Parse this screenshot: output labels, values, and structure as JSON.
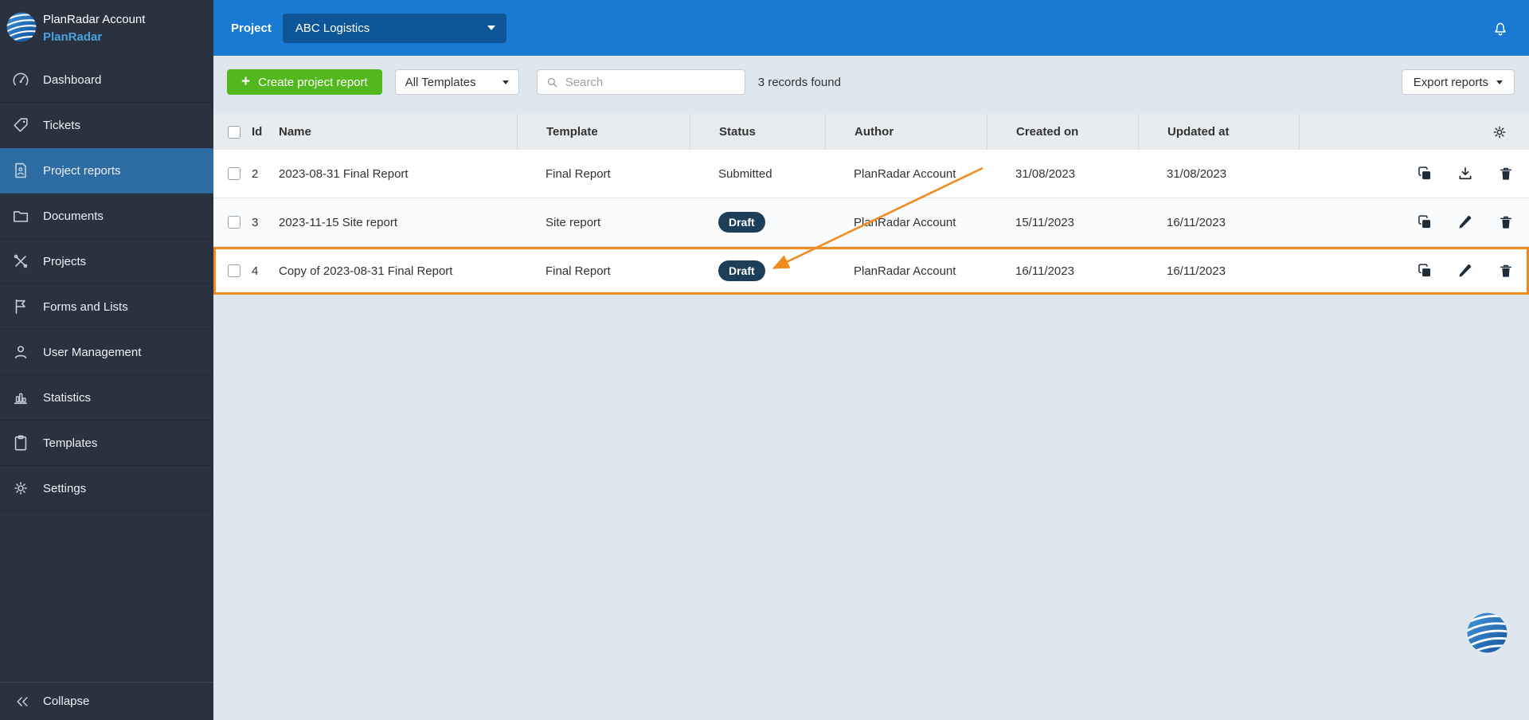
{
  "sidebar": {
    "account_name": "PlanRadar Account",
    "brand_name": "PlanRadar",
    "items": [
      {
        "label": "Dashboard",
        "icon": "dashboard-icon",
        "active": false
      },
      {
        "label": "Tickets",
        "icon": "tickets-icon",
        "active": false
      },
      {
        "label": "Project reports",
        "icon": "project-reports-icon",
        "active": true
      },
      {
        "label": "Documents",
        "icon": "documents-icon",
        "active": false
      },
      {
        "label": "Projects",
        "icon": "projects-icon",
        "active": false
      },
      {
        "label": "Forms and Lists",
        "icon": "forms-and-lists-icon",
        "active": false
      },
      {
        "label": "User Management",
        "icon": "user-management-icon",
        "active": false
      },
      {
        "label": "Statistics",
        "icon": "statistics-icon",
        "active": false
      },
      {
        "label": "Templates",
        "icon": "templates-icon",
        "active": false
      },
      {
        "label": "Settings",
        "icon": "settings-icon",
        "active": false
      }
    ],
    "collapse_label": "Collapse"
  },
  "header": {
    "project_label": "Project",
    "selected_project": "ABC Logistics"
  },
  "toolbar": {
    "create_button_label": "Create project report",
    "templates_filter_value": "All Templates",
    "search_placeholder": "Search",
    "records_found": "3 records found",
    "export_button_label": "Export reports"
  },
  "table": {
    "columns": [
      "Id",
      "Name",
      "Template",
      "Status",
      "Author",
      "Created on",
      "Updated at"
    ],
    "rows": [
      {
        "id": "2",
        "name": "2023-08-31 Final Report",
        "template": "Final Report",
        "status": "Submitted",
        "status_is_badge": false,
        "author": "PlanRadar Account",
        "created_on": "31/08/2023",
        "updated_at": "31/08/2023",
        "actions": [
          "copy",
          "download",
          "delete"
        ],
        "highlighted": false
      },
      {
        "id": "3",
        "name": "2023-11-15 Site report",
        "template": "Site report",
        "status": "Draft",
        "status_is_badge": true,
        "author": "PlanRadar Account",
        "created_on": "15/11/2023",
        "updated_at": "16/11/2023",
        "actions": [
          "copy",
          "edit",
          "delete"
        ],
        "highlighted": false
      },
      {
        "id": "4",
        "name": "Copy of 2023-08-31 Final Report",
        "template": "Final Report",
        "status": "Draft",
        "status_is_badge": true,
        "author": "PlanRadar Account",
        "created_on": "16/11/2023",
        "updated_at": "16/11/2023",
        "actions": [
          "copy",
          "edit",
          "delete"
        ],
        "highlighted": true
      }
    ]
  },
  "annotation": {
    "type": "arrow",
    "color": "#f28a1e",
    "points_to": "Draft status badge of row id 4"
  },
  "colors": {
    "header_blue": "#187ad2",
    "sidebar_dark": "#2a323f",
    "active_item_blue": "#2d6ba3",
    "create_button_green": "#53b71e",
    "draft_badge_navy": "#1d3e59",
    "highlight_orange": "#f28a1e"
  }
}
